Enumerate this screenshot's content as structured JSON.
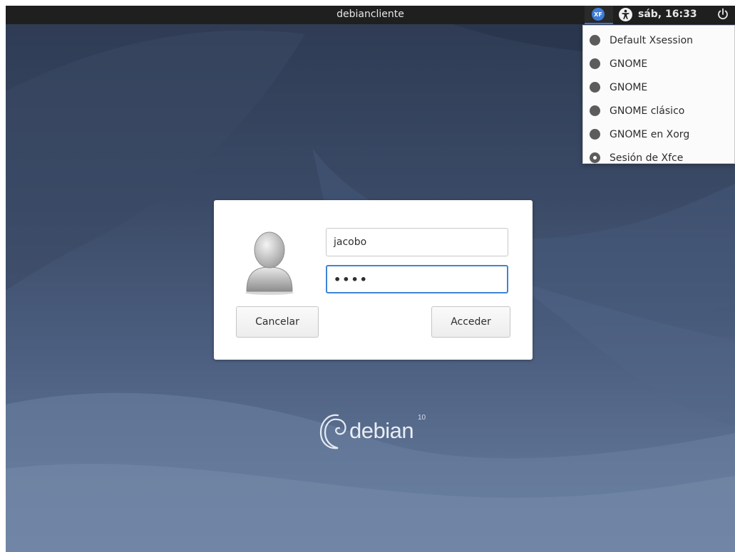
{
  "top_panel": {
    "hostname": "debiancliente",
    "session_icon_text": "XF",
    "clock": "sáb, 16:33"
  },
  "session_menu": {
    "items": [
      {
        "label": "Default Xsession",
        "selected": false
      },
      {
        "label": "GNOME",
        "selected": false
      },
      {
        "label": "GNOME",
        "selected": false
      },
      {
        "label": "GNOME clásico",
        "selected": false
      },
      {
        "label": "GNOME en Xorg",
        "selected": false
      },
      {
        "label": "Sesión de Xfce",
        "selected": true
      }
    ]
  },
  "login": {
    "username": "jacobo",
    "password_mask": "••••",
    "cancel_label": "Cancelar",
    "login_label": "Acceder"
  },
  "branding": {
    "name": "debian",
    "version": "10"
  },
  "colors": {
    "panel_bg": "#1f1f1f",
    "accent": "#3d7dd8",
    "focus_border": "#3e84d6"
  },
  "icons": [
    "session-xfce-icon",
    "accessibility-icon",
    "power-icon",
    "user-avatar-icon",
    "debian-swirl-icon"
  ]
}
